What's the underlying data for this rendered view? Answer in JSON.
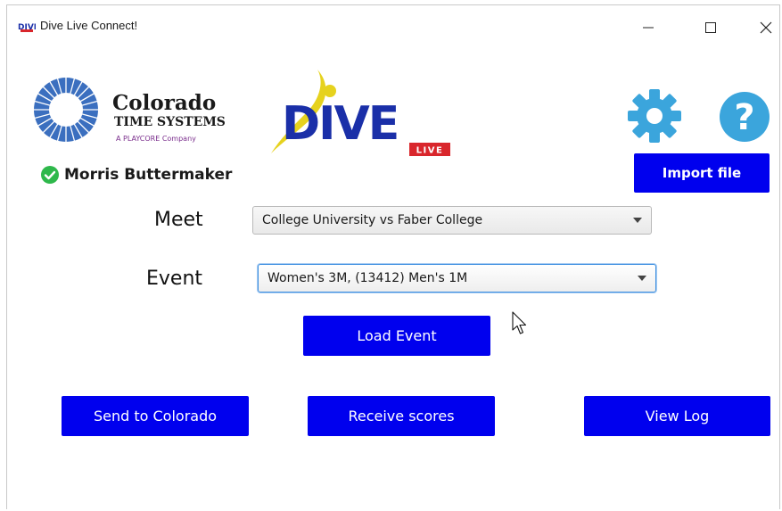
{
  "window": {
    "title": "Dive Live Connect!",
    "controls": [
      "minimize",
      "maximize",
      "close"
    ]
  },
  "logos": {
    "cts": {
      "line1": "Colorado",
      "line2": "TIME SYSTEMS",
      "line3": "A PLAYCORE Company"
    },
    "dive": {
      "word": "DIVE",
      "badge": "LIVE"
    }
  },
  "header_icons": {
    "settings": "gear-icon",
    "help": "help-icon"
  },
  "user": {
    "name": "Morris Buttermaker",
    "status_icon": "check-circle-icon",
    "status_color": "#2eb84b"
  },
  "buttons": {
    "import": "Import file",
    "load_event": "Load Event",
    "send": "Send to Colorado",
    "receive": "Receive scores",
    "view_log": "View Log"
  },
  "form": {
    "meet_label": "Meet",
    "meet_value": "College University vs Faber College",
    "event_label": "Event",
    "event_value": "Women's 3M, (13412) Men's 1M"
  },
  "colors": {
    "button": "#0000ee",
    "accent": "#3ba5dc",
    "dive_blue": "#1a2fa8",
    "dive_yellow": "#e6d21e",
    "live_red": "#d9262c"
  }
}
